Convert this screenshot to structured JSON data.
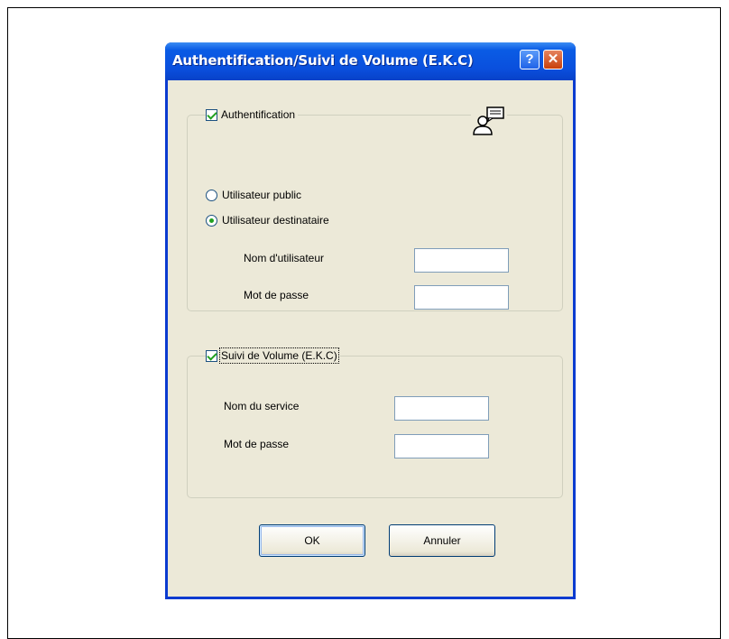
{
  "dialog": {
    "title": "Authentification/Suivi de Volume  (E.K.C)",
    "help_button": "?",
    "close_button": "✕"
  },
  "authentication": {
    "checkbox_label": "Authentification",
    "checked": true,
    "icon": "user-account-icon",
    "options": [
      {
        "label": "Utilisateur public",
        "selected": false
      },
      {
        "label": "Utilisateur destinataire",
        "selected": true
      }
    ],
    "username_label": "Nom d'utilisateur",
    "username_value": "",
    "password_label": "Mot de passe",
    "password_value": ""
  },
  "volume_tracking": {
    "checkbox_label": "Suivi de Volume  (E.K.C)",
    "checked": true,
    "service_label": "Nom du service",
    "service_value": "",
    "password_label": "Mot de passe",
    "password_value": ""
  },
  "buttons": {
    "ok": "OK",
    "cancel": "Annuler"
  },
  "colors": {
    "titlebar": "#0a4fdd",
    "client_background": "#ece9d8",
    "check_mark": "#21a121"
  }
}
